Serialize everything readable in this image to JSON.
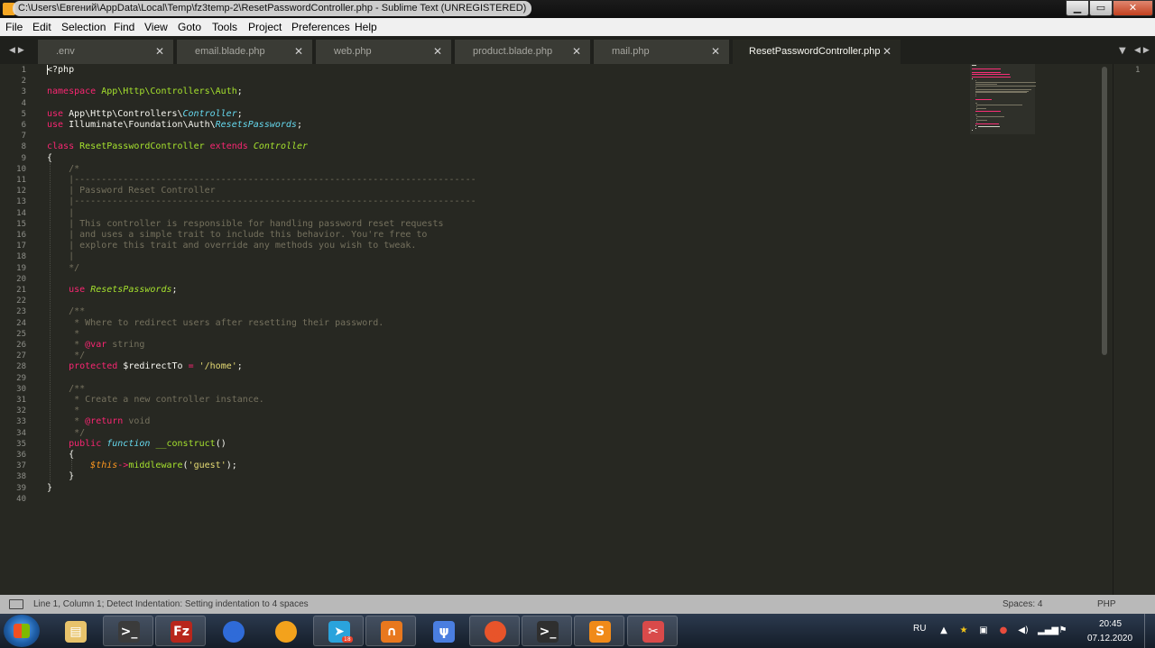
{
  "window": {
    "title": "C:\\Users\\Евгений\\AppData\\Local\\Temp\\fz3temp-2\\ResetPasswordController.php - Sublime Text (UNREGISTERED)",
    "min_glyph": "▁",
    "max_glyph": "▭",
    "close_glyph": "✕"
  },
  "menu": [
    "File",
    "Edit",
    "Selection",
    "Find",
    "View",
    "Goto",
    "Tools",
    "Project",
    "Preferences",
    "Help"
  ],
  "tabs": [
    {
      "label": ".env",
      "active": false
    },
    {
      "label": "email.blade.php",
      "active": false
    },
    {
      "label": "web.php",
      "active": false
    },
    {
      "label": "product.blade.php",
      "active": false
    },
    {
      "label": "mail.php",
      "active": false
    },
    {
      "label": "ResetPasswordController.php",
      "active": true
    }
  ],
  "tab_close_glyph": "✕",
  "nav_glyphs": {
    "left": "◀▶",
    "right": "◀▶",
    "dropdown": "▼"
  },
  "editor": {
    "line_numbers": [
      "1",
      "2",
      "3",
      "4",
      "5",
      "6",
      "7",
      "8",
      "9",
      "10",
      "11",
      "12",
      "13",
      "14",
      "15",
      "16",
      "17",
      "18",
      "19",
      "20",
      "21",
      "22",
      "23",
      "24",
      "25",
      "26",
      "27",
      "28",
      "29",
      "30",
      "31",
      "32",
      "33",
      "34",
      "35",
      "36",
      "37",
      "38",
      "39",
      "40"
    ],
    "lines": [
      "<?php",
      "",
      "namespace App\\Http\\Controllers\\Auth;",
      "",
      "use App\\Http\\Controllers\\Controller;",
      "use Illuminate\\Foundation\\Auth\\ResetsPasswords;",
      "",
      "class ResetPasswordController extends Controller",
      "{",
      "    /*",
      "    |--------------------------------------------------------------------------",
      "    | Password Reset Controller",
      "    |--------------------------------------------------------------------------",
      "    |",
      "    | This controller is responsible for handling password reset requests",
      "    | and uses a simple trait to include this behavior. You're free to",
      "    | explore this trait and override any methods you wish to tweak.",
      "    |",
      "    */",
      "",
      "    use ResetsPasswords;",
      "",
      "    /**",
      "     * Where to redirect users after resetting their password.",
      "     *",
      "     * @var string",
      "     */",
      "    protected $redirectTo = '/home';",
      "",
      "    /**",
      "     * Create a new controller instance.",
      "     *",
      "     * @return void",
      "     */",
      "    public function __construct()",
      "    {",
      "        $this->middleware('guest');",
      "    }",
      "}",
      ""
    ],
    "right_pane_line": "1"
  },
  "status": {
    "message": "Line 1, Column 1; Detect Indentation: Setting indentation to 4 spaces",
    "indent": "Spaces: 4",
    "syntax": "PHP"
  },
  "taskbar": {
    "apps": [
      {
        "name": "explorer",
        "glyph": "▤",
        "color": "#e8c36b"
      },
      {
        "name": "terminal",
        "glyph": ">_",
        "color": "#3b3b3b"
      },
      {
        "name": "filezilla",
        "glyph": "Fz",
        "color": "#b8261c"
      },
      {
        "name": "firefox-dev",
        "glyph": "●",
        "color": "#2f6bd8"
      },
      {
        "name": "chrome-canary",
        "glyph": "●",
        "color": "#f3a21c"
      },
      {
        "name": "telegram",
        "glyph": "➤",
        "color": "#2aa3dc",
        "badge": "18"
      },
      {
        "name": "openvpn",
        "glyph": "∩",
        "color": "#e8781e"
      },
      {
        "name": "vscodium",
        "glyph": "ψ",
        "color": "#4a7ee0"
      },
      {
        "name": "firefox",
        "glyph": "●",
        "color": "#e8542a"
      },
      {
        "name": "cmd",
        "glyph": ">_",
        "color": "#2f2f2f"
      },
      {
        "name": "sublime",
        "glyph": "S",
        "color": "#f08a19"
      },
      {
        "name": "snipping",
        "glyph": "✂",
        "color": "#d94a4a"
      }
    ],
    "language": "RU",
    "time": "20:45",
    "date": "07.12.2020"
  }
}
